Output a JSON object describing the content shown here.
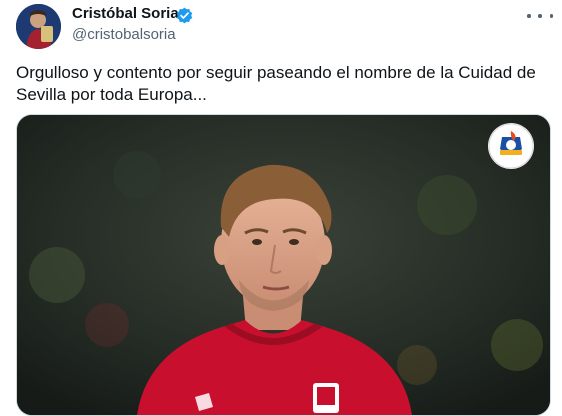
{
  "author": {
    "name": "Cristóbal Soria",
    "handle": "@cristobalsoria",
    "verified": true,
    "avatar_icon": "profile-photo"
  },
  "post": {
    "text_line1": "Orgulloso y contento por seguir paseando el nombre de la Cuidad de",
    "text_line2": "Sevilla por toda Europa..."
  },
  "media": {
    "type": "photo",
    "description_icon": "player-photo",
    "watermark_icon": "logo-badge-icon"
  },
  "colors": {
    "verified_blue": "#1d9bf0",
    "text_primary": "#0f1419",
    "text_secondary": "#536471",
    "jersey_red": "#c8102e"
  }
}
